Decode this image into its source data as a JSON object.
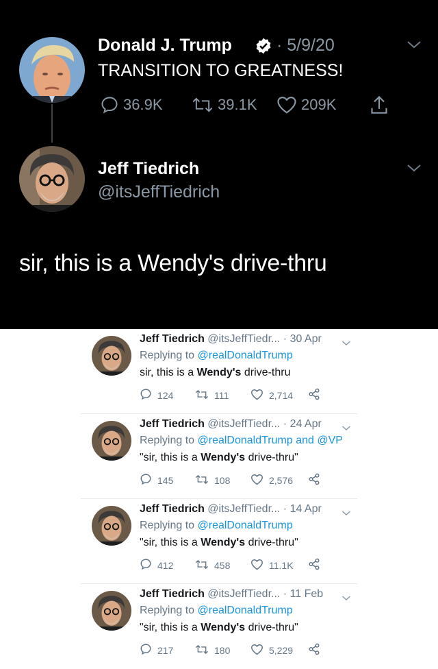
{
  "main_tweet": {
    "name": "Donald J. Trump",
    "date": "· 5/9/20",
    "text": "TRANSITION TO GREATNESS!",
    "replies": "36.9K",
    "retweets": "39.1K",
    "likes": "209K"
  },
  "reply_tweet": {
    "name": "Jeff Tiedrich",
    "handle": "@itsJeffTiedrich",
    "text": "sir, this is a Wendy's drive-thru"
  },
  "older_tweets": [
    {
      "name": "Jeff Tiedrich",
      "handle_date": "@itsJeffTiedr... · 30 Apr",
      "replying_prefix": "Replying to ",
      "replying_to": "@realDonaldTrump",
      "text_before": "sir, this is a ",
      "text_bold": "Wendy's",
      "text_after": " drive-thru",
      "replies": "124",
      "retweets": "111",
      "likes": "2,714"
    },
    {
      "name": "Jeff Tiedrich",
      "handle_date": "@itsJeffTiedr... · 24 Apr",
      "replying_prefix": "Replying to ",
      "replying_to": "@realDonaldTrump and @VP",
      "text_before": "\"sir, this is a ",
      "text_bold": "Wendy's",
      "text_after": " drive-thru\"",
      "replies": "145",
      "retweets": "108",
      "likes": "2,576"
    },
    {
      "name": "Jeff Tiedrich",
      "handle_date": "@itsJeffTiedr... · 14 Apr",
      "replying_prefix": "Replying to ",
      "replying_to": "@realDonaldTrump",
      "text_before": "\"sir, this is a ",
      "text_bold": "Wendy's",
      "text_after": " drive-thru\"",
      "replies": "412",
      "retweets": "458",
      "likes": "11.1K"
    },
    {
      "name": "Jeff Tiedrich",
      "handle_date": "@itsJeffTiedr... · 11 Feb",
      "replying_prefix": "Replying to ",
      "replying_to": "@realDonaldTrump",
      "text_before": "\"sir, this is a ",
      "text_bold": "Wendy's",
      "text_after": " drive-thru\"",
      "replies": "217",
      "retweets": "180",
      "likes": "5,229"
    }
  ],
  "icons": {
    "reply": "reply-icon",
    "retweet": "retweet-icon",
    "like": "heart-icon",
    "share": "share-icon",
    "verified": "verified-badge-icon",
    "caret": "chevron-down-icon"
  },
  "colors": {
    "dark_bg": "#000000",
    "dark_muted": "#8b98a5",
    "link": "#1b95e0",
    "light_muted": "#657786"
  }
}
